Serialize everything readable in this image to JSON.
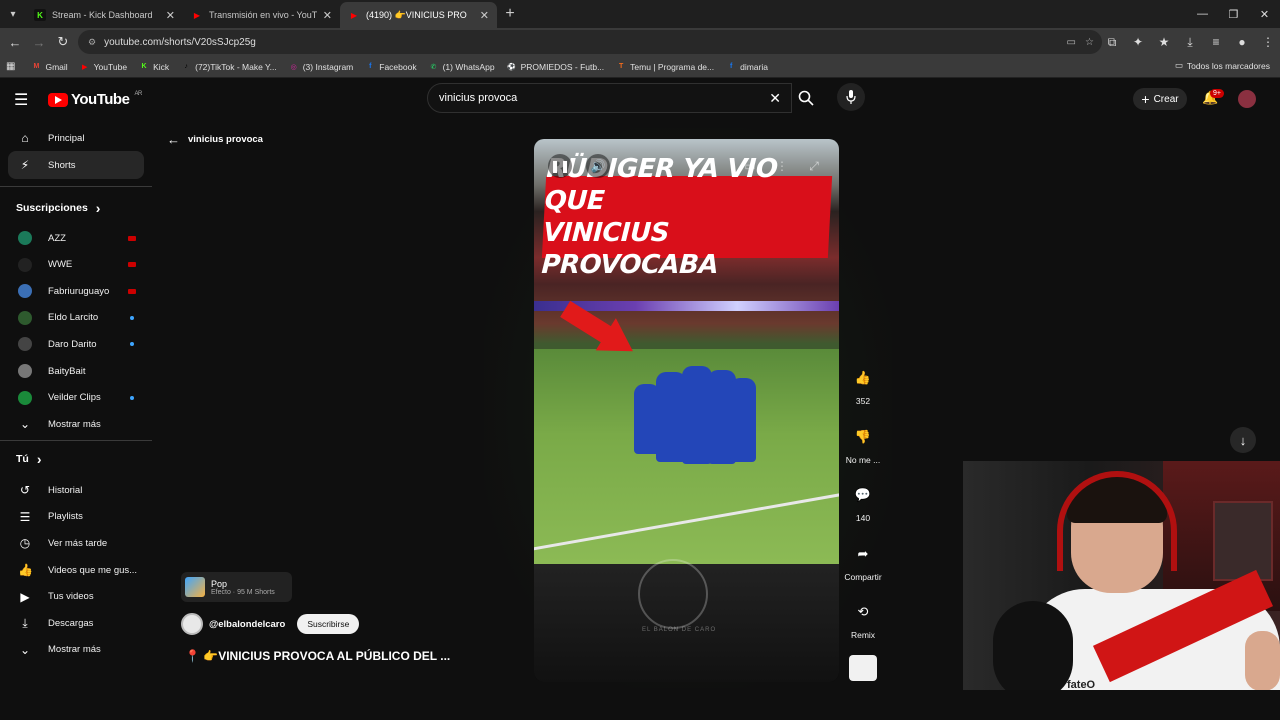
{
  "browser": {
    "tabs": [
      {
        "title": "Stream - Kick Dashboard",
        "fav": "K",
        "fav_color": "#53fc18",
        "active": false
      },
      {
        "title": "Transmisión en vivo - YouTube",
        "fav": "▶",
        "fav_color": "#ff0000",
        "active": false
      },
      {
        "title": "(4190) 👉VINICIUS PRO",
        "fav": "▶",
        "fav_color": "#ff0000",
        "active": true
      }
    ],
    "url": "youtube.com/shorts/V20sSJcp25g",
    "bookmarks": [
      {
        "label": "Gmail",
        "icon": "M",
        "color": "#ea4335"
      },
      {
        "label": "YouTube",
        "icon": "▶",
        "color": "#ff0000"
      },
      {
        "label": "Kick",
        "icon": "K",
        "color": "#53fc18"
      },
      {
        "label": "(72)TikTok - Make Y...",
        "icon": "♪",
        "color": "#000000"
      },
      {
        "label": "(3) Instagram",
        "icon": "◎",
        "color": "#d6249f"
      },
      {
        "label": "Facebook",
        "icon": "f",
        "color": "#1877f2"
      },
      {
        "label": "(1) WhatsApp",
        "icon": "✆",
        "color": "#25d366"
      },
      {
        "label": "PROMIEDOS - Futb...",
        "icon": "⚽",
        "color": "#2ecc40"
      },
      {
        "label": "Temu | Programa de...",
        "icon": "T",
        "color": "#f26b1d"
      },
      {
        "label": "dimaria",
        "icon": "f",
        "color": "#1877f2"
      }
    ],
    "bookmarks_all": "Todos los marcadores"
  },
  "header": {
    "logo_text": "YouTube",
    "logo_region": "AR",
    "search_value": "vinicius provoca",
    "create_label": "Crear",
    "notif_badge": "9+"
  },
  "sidebar": {
    "main": [
      {
        "label": "Principal",
        "icon": "⌂"
      },
      {
        "label": "Shorts",
        "icon": "⚡",
        "active": true
      }
    ],
    "subs_title": "Suscripciones",
    "subs": [
      {
        "label": "AZZ",
        "status": "live",
        "color": "#1b7a5a"
      },
      {
        "label": "WWE",
        "status": "live",
        "color": "#222222"
      },
      {
        "label": "Fabriuruguayo",
        "status": "live",
        "color": "#3b6fb5"
      },
      {
        "label": "Eldo Larcito",
        "status": "new",
        "color": "#2e5a2e"
      },
      {
        "label": "Daro Darito",
        "status": "new",
        "color": "#444444"
      },
      {
        "label": "BaityBait",
        "status": "",
        "color": "#777777"
      },
      {
        "label": "Veilder Clips",
        "status": "new",
        "color": "#1a8a3a"
      }
    ],
    "subs_more": "Mostrar más",
    "you_title": "Tú",
    "you": [
      {
        "label": "Historial",
        "icon": "↺"
      },
      {
        "label": "Playlists",
        "icon": "☰"
      },
      {
        "label": "Ver más tarde",
        "icon": "◷"
      },
      {
        "label": "Videos que me gus...",
        "icon": "👍"
      },
      {
        "label": "Tus videos",
        "icon": "▶"
      },
      {
        "label": "Descargas",
        "icon": "⤓"
      }
    ],
    "you_more": "Mostrar más"
  },
  "main": {
    "back_label": "vinicius provoca",
    "video_banner_line1": "RÜDIGER YA VIO QUE",
    "video_banner_line2": "VINICIUS PROVOCABA",
    "watermark": "EL BALON DE CARO",
    "actions": {
      "like_count": "352",
      "dislike_label": "No me ...",
      "comments_count": "140",
      "share_label": "Compartir",
      "remix_label": "Remix"
    },
    "effect_name": "Pop",
    "effect_sub": "Efecto · 95 M Shorts",
    "channel_handle": "@elbalondelcaro",
    "subscribe_label": "Suscribirse",
    "video_title": "📍 👉VINICIUS PROVOCA AL PÚBLICO DEL ..."
  },
  "webcam": {
    "shirt_text": "fateO"
  }
}
